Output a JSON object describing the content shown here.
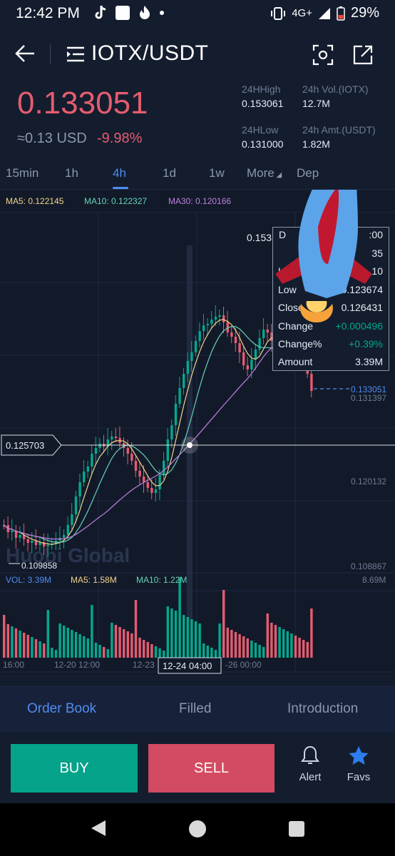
{
  "status": {
    "time": "12:42 PM",
    "network": "4G+",
    "battery": "29%"
  },
  "header": {
    "pair": "IOTX/USDT"
  },
  "price": {
    "last": "0.133051",
    "usd": "≈0.13 USD",
    "change_pct": "-9.98%",
    "high_label": "24HHigh",
    "high_value": "0.153061",
    "vol_label": "24h Vol.(IOTX)",
    "vol_value": "12.7M",
    "low_label": "24HLow",
    "low_value": "0.131000",
    "amt_label": "24h Amt.(USDT)",
    "amt_value": "1.82M"
  },
  "timeframes": [
    "15min",
    "1h",
    "4h",
    "1d",
    "1w",
    "More",
    "Dep"
  ],
  "active_timeframe": "4h",
  "chart": {
    "ma5": "MA5: 0.122145",
    "ma10": "MA10: 0.122327",
    "ma30": "MA30: 0.120166",
    "price_labels": [
      "0.153",
      "0.133051",
      "0.131397",
      "0.120132",
      "0.108867"
    ],
    "crosshair_price": "0.125703",
    "low_marker": "0.109858",
    "watermark": "Huobi Global",
    "vol_label": "VOL: 3.39M",
    "vol_ma5": "MA5: 1.58M",
    "vol_ma10": "MA10: 1.22M",
    "vol_max": "8.69M",
    "time_labels": [
      "16:00",
      "12-20 12:00",
      "12-23",
      "-26 00:00"
    ],
    "crosshair_time": "12-24 04:00",
    "tooltip": {
      "date_fragment": "D",
      "time_fragment": ":00",
      "open_fragment": "35",
      "rows": [
        {
          "label": "High",
          "value": "10"
        },
        {
          "label": "Low",
          "value": "0.123674"
        },
        {
          "label": "Close",
          "value": "0.126431"
        },
        {
          "label": "Change",
          "value": "+0.000496"
        },
        {
          "label": "Change%",
          "value": "+0.39%"
        },
        {
          "label": "Amount",
          "value": "3.39M"
        }
      ]
    }
  },
  "tabs": [
    "Order Book",
    "Filled",
    "Introduction"
  ],
  "actions": {
    "buy": "BUY",
    "sell": "SELL",
    "alert": "Alert",
    "favs": "Favs"
  },
  "colors": {
    "up": "#03a88d",
    "down": "#e55c6f",
    "accent": "#4f8cf1",
    "ma5": "#f4d38a",
    "ma10": "#67d1b9",
    "ma30": "#c07ee0"
  }
}
